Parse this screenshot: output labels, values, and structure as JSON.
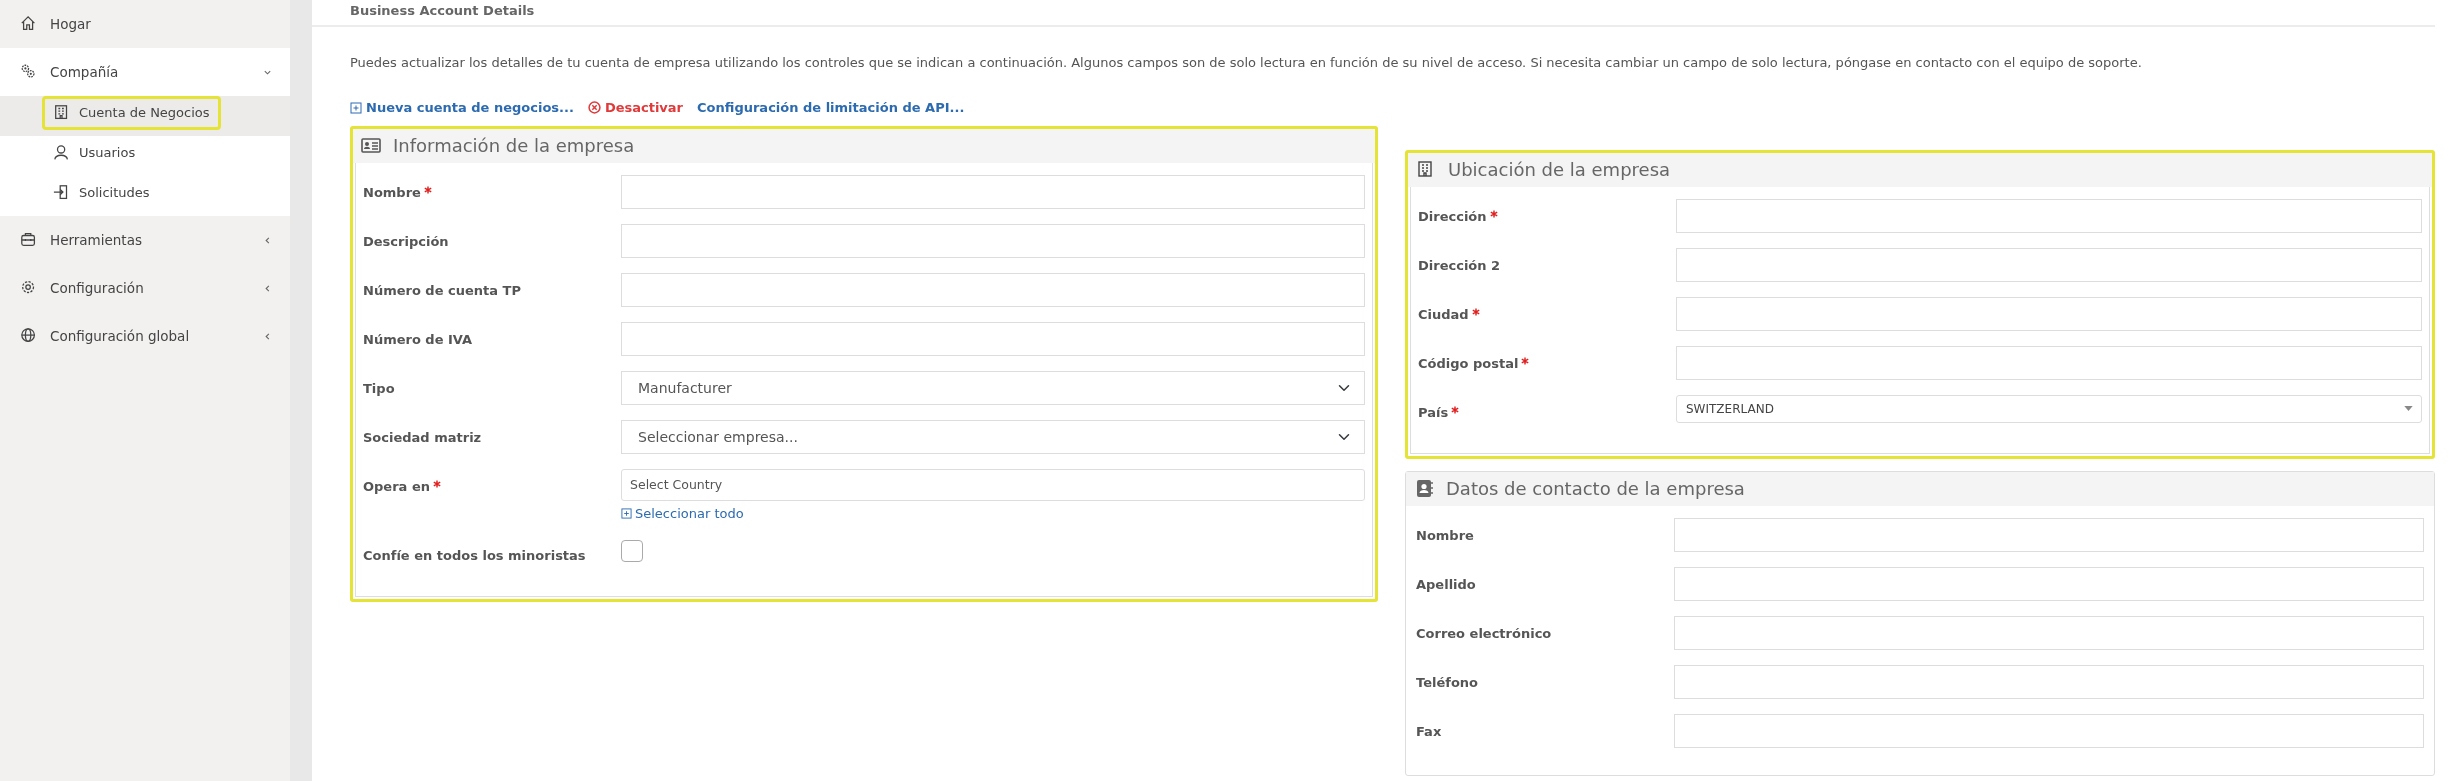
{
  "sidebar": {
    "items": [
      {
        "label": "Hogar"
      },
      {
        "label": "Compañía",
        "expanded": true,
        "children": [
          {
            "label": "Cuenta de Negocios",
            "selected": true,
            "highlighted": true
          },
          {
            "label": "Usuarios",
            "selected": false,
            "highlighted": false
          },
          {
            "label": "Solicitudes",
            "selected": false,
            "highlighted": false
          }
        ]
      },
      {
        "label": "Herramientas",
        "expanded": false
      },
      {
        "label": "Configuración",
        "expanded": false
      },
      {
        "label": "Configuración global",
        "expanded": false
      }
    ]
  },
  "page": {
    "title": "Business Account Details",
    "description": "Puedes actualizar los detalles de tu cuenta de empresa utilizando los controles que se indican a continuación. Algunos campos son de solo lectura en función de su nivel de acceso. Si necesita cambiar un campo de solo lectura, póngase en contacto con el equipo de soporte.",
    "actions": [
      {
        "label": "Nueva cuenta de negocios...",
        "kind": "add"
      },
      {
        "label": "Desactivar",
        "kind": "danger"
      },
      {
        "label": "Configuración de limitación de API...",
        "kind": "link"
      }
    ]
  },
  "columns": [
    [
      {
        "title": "Información de la empresa",
        "highlighted": true,
        "fields": [
          {
            "label": "Nombre",
            "kind": "text",
            "required": true
          },
          {
            "label": "Descripción",
            "kind": "text",
            "required": false
          },
          {
            "label": "Número de cuenta TP",
            "kind": "text",
            "required": false
          },
          {
            "label": "Número de IVA",
            "kind": "text",
            "required": false
          },
          {
            "label": "Tipo",
            "kind": "select",
            "required": false,
            "value": "Manufacturer"
          },
          {
            "label": "Sociedad matriz",
            "kind": "select",
            "required": false,
            "value": "Seleccionar empresa..."
          },
          {
            "label": "Opera en",
            "kind": "multi",
            "required": true,
            "placeholder": "Select Country",
            "link": "Seleccionar todo"
          },
          {
            "label": "Confíe en todos los minoristas",
            "kind": "checkbox",
            "required": false,
            "checked": false
          }
        ]
      }
    ],
    [
      {
        "title": "Ubicación de la empresa",
        "highlighted": true,
        "fields": [
          {
            "label": "Dirección",
            "kind": "text",
            "required": true
          },
          {
            "label": "Dirección 2",
            "kind": "text",
            "required": false
          },
          {
            "label": "Ciudad",
            "kind": "text",
            "required": true
          },
          {
            "label": "Código postal",
            "kind": "text",
            "required": true
          },
          {
            "label": "País",
            "kind": "combo",
            "required": true,
            "value": "SWITZERLAND"
          }
        ]
      },
      {
        "title": "Datos de contacto de la empresa",
        "highlighted": false,
        "fields": [
          {
            "label": "Nombre",
            "kind": "text",
            "required": false
          },
          {
            "label": "Apellido",
            "kind": "text",
            "required": false
          },
          {
            "label": "Correo electrónico",
            "kind": "text",
            "required": false
          },
          {
            "label": "Teléfono",
            "kind": "text",
            "required": false
          },
          {
            "label": "Fax",
            "kind": "text",
            "required": false
          }
        ]
      }
    ]
  ]
}
